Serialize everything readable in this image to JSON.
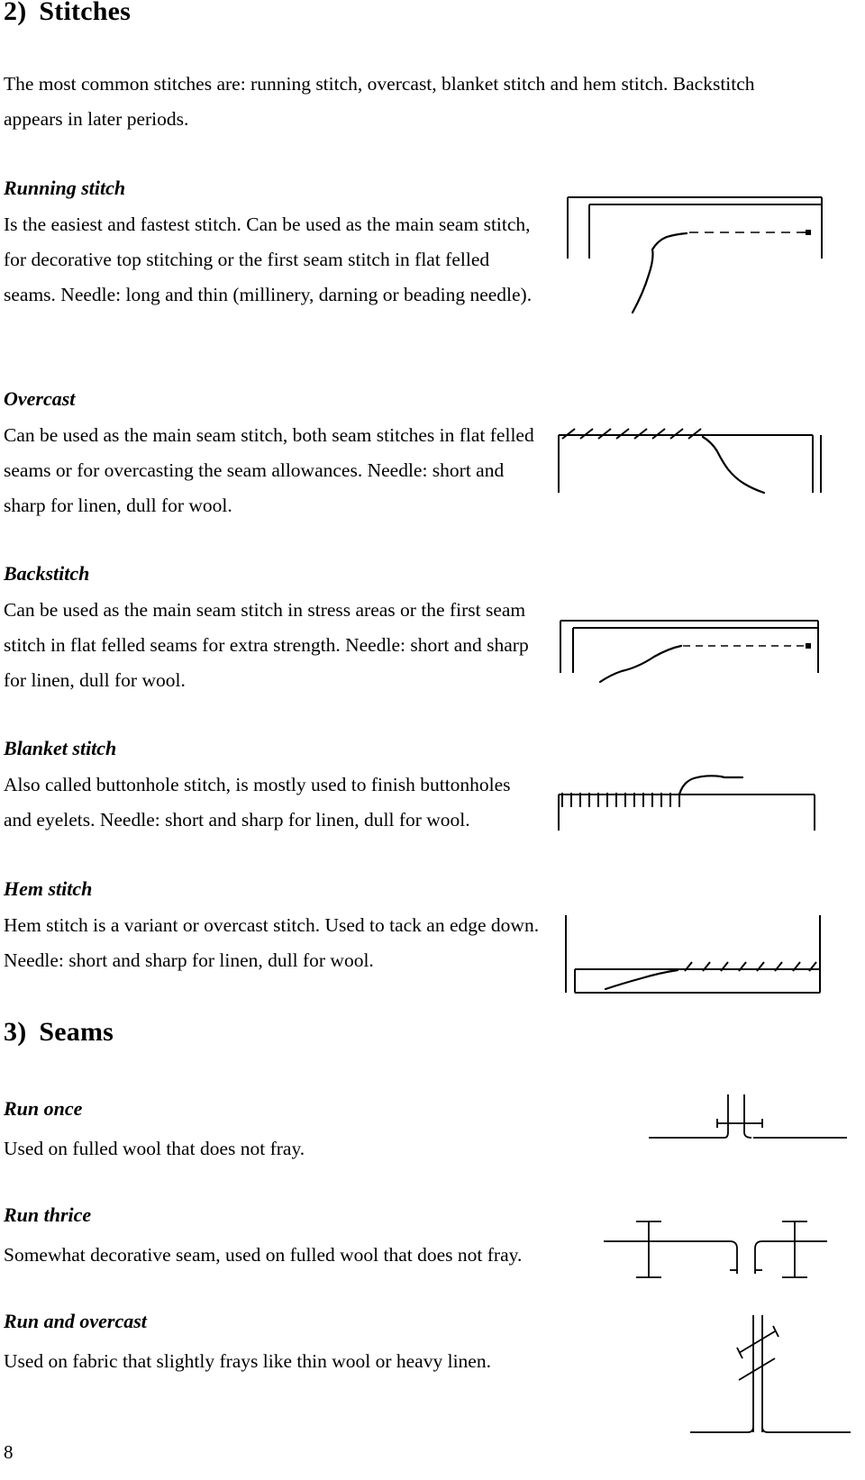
{
  "page": {
    "number": "8"
  },
  "sections": {
    "stitches": {
      "number": "2)",
      "title": "Stitches",
      "intro": "The most common stitches are: running stitch, overcast, blanket stitch and hem stitch. Backstitch appears in later periods."
    },
    "seams": {
      "number": "3)",
      "title": "Seams"
    }
  },
  "stitch_entries": [
    {
      "heading": "Running stitch",
      "text": "Is the easiest and fastest stitch. Can be used as the main seam stitch, for decorative top stitching or the first seam stitch in flat felled seams. Needle: long and thin (millinery, darning or beading needle).",
      "figure": "running-stitch-diagram"
    },
    {
      "heading": "Overcast",
      "text": "Can be used as the main seam stitch, both seam stitches in flat felled seams or for overcasting the seam allowances. Needle: short and sharp for linen, dull for wool.",
      "figure": "overcast-stitch-diagram"
    },
    {
      "heading": "Backstitch",
      "text": "Can be used as the main seam stitch in stress areas or the first seam stitch in flat felled seams for extra strength. Needle: short and sharp for linen, dull for wool.",
      "figure": "backstitch-diagram"
    },
    {
      "heading": "Blanket stitch",
      "text": "Also called buttonhole stitch, is mostly used to finish buttonholes and eyelets. Needle: short and sharp for linen, dull for wool.",
      "figure": "blanket-stitch-diagram"
    },
    {
      "heading": "Hem stitch",
      "text": "Hem stitch is a variant or overcast stitch. Used to tack an edge down. Needle: short and sharp for linen, dull for wool.",
      "figure": "hem-stitch-diagram"
    }
  ],
  "seam_entries": [
    {
      "heading": "Run once",
      "text": "Used on fulled wool that does not fray.",
      "figure": "run-once-diagram"
    },
    {
      "heading": "Run thrice",
      "text": "Somewhat decorative seam, used on fulled wool that does not fray.",
      "figure": "run-thrice-diagram"
    },
    {
      "heading": "Run and overcast",
      "text": "Used on fabric that slightly frays like thin wool or heavy linen.",
      "figure": "run-and-overcast-diagram"
    }
  ],
  "colors": {
    "ink": "#000000",
    "paper": "#ffffff"
  }
}
